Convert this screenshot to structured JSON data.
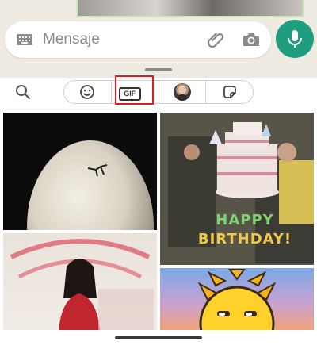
{
  "composer": {
    "placeholder": "Mensaje",
    "icons": {
      "keyboard": "keyboard-icon",
      "attach": "paperclip-icon",
      "camera": "camera-icon",
      "mic": "microphone-icon"
    },
    "accent_color": "#1e9e7e"
  },
  "panel": {
    "search_icon": "search-icon",
    "tabs": [
      {
        "id": "emoji",
        "icon": "smiley-icon",
        "selected": false
      },
      {
        "id": "gif",
        "label": "GIF",
        "selected": true
      },
      {
        "id": "avatar",
        "icon": "avatar-icon",
        "selected": false
      },
      {
        "id": "stickers",
        "icon": "sticker-icon",
        "selected": false
      }
    ],
    "highlight_color": "#e0191e"
  },
  "gifs": [
    {
      "id": "gif-egg",
      "subject": "figure on white egg"
    },
    {
      "id": "gif-birthday",
      "caption_line1": "HAPPY",
      "caption_line2": "BIRTHDAY!"
    },
    {
      "id": "gif-woman",
      "subject": "woman in red"
    },
    {
      "id": "gif-sun",
      "subject": "cartoon sun"
    }
  ]
}
